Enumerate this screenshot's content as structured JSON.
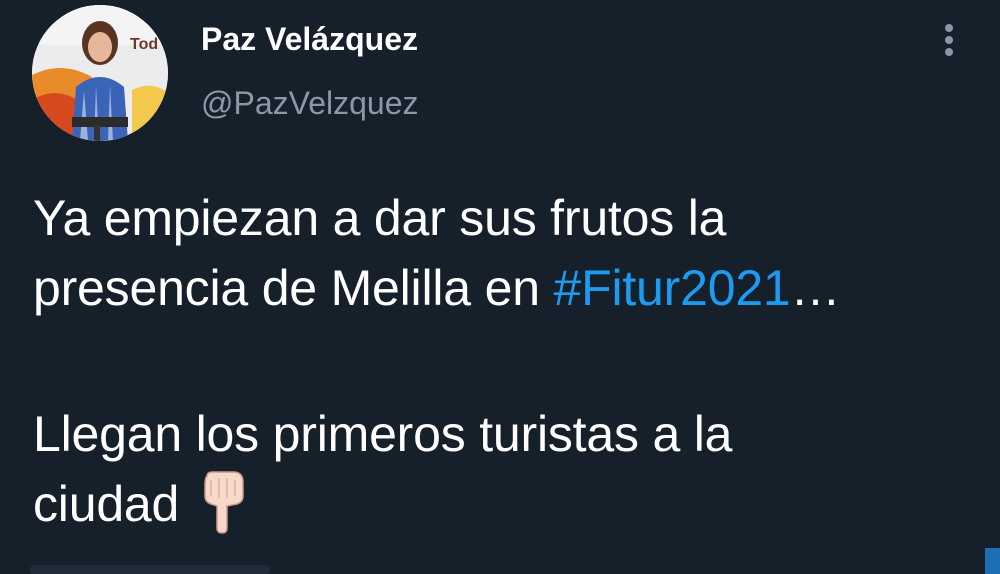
{
  "author": {
    "display_name": "Paz Velázquez",
    "handle": "@PazVelzquez",
    "avatar_icon": "profile-photo"
  },
  "menu": {
    "icon": "more-vertical-icon"
  },
  "tweet": {
    "line1": "Ya empiezan a dar sus frutos la",
    "line2_prefix": "presencia de Melilla en ",
    "hashtag": "#Fitur2021",
    "ellipsis": "…",
    "line3": "Llegan los primeros turistas a la",
    "line4": "ciudad",
    "emoji_icon": "pointing-down-hand-emoji"
  },
  "colors": {
    "background": "#15202b",
    "text": "#ffffff",
    "secondary": "#8b98a5",
    "link": "#1d9bf0"
  }
}
